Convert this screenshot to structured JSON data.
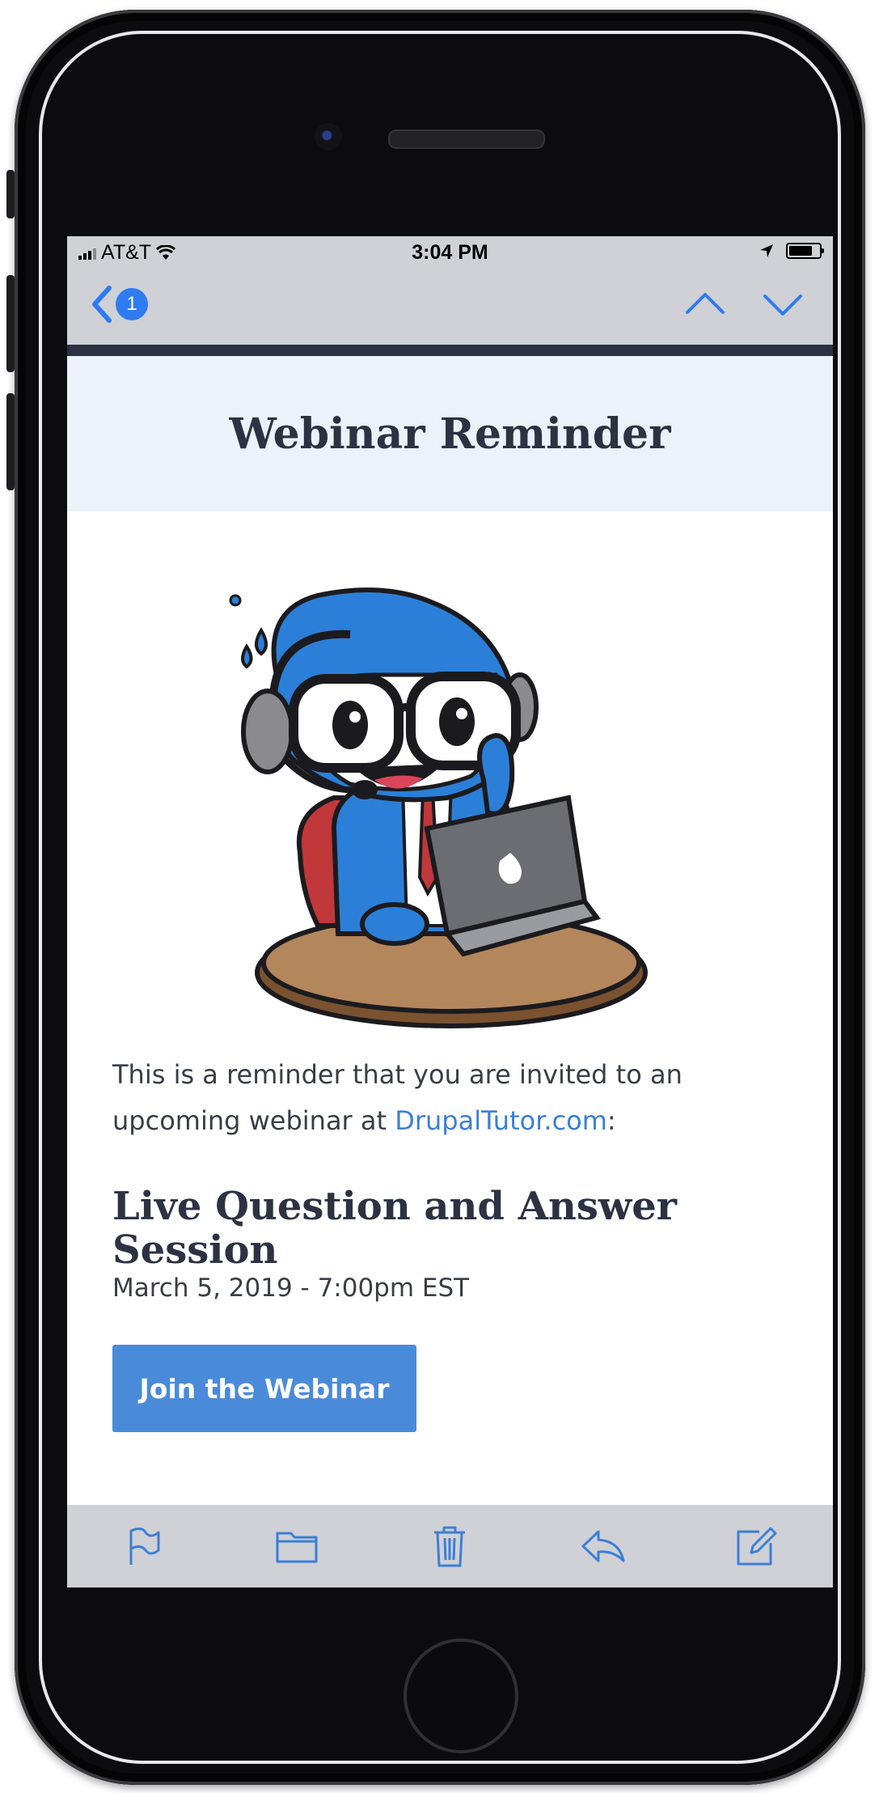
{
  "status_bar": {
    "carrier": "AT&T",
    "time": "3:04 PM"
  },
  "nav": {
    "unread_count": "1",
    "icons": [
      "chevron-left-icon",
      "chevron-up-icon",
      "chevron-down-icon"
    ]
  },
  "email": {
    "header_title": "Webinar Reminder",
    "intro_text": "This is a reminder that you are invited to an upcoming webinar at ",
    "intro_link": "DrupalTutor.com",
    "intro_suffix": ":",
    "webinar_title": "Live Question and Answer Session",
    "webinar_date": "March 5, 2019 - 7:00pm EST",
    "cta_label": "Join the Webinar"
  },
  "toolbar": {
    "icons": [
      "flag-icon",
      "folder-icon",
      "trash-icon",
      "reply-icon",
      "compose-icon"
    ]
  },
  "colors": {
    "accent": "#2f7bf0",
    "link": "#3b7fd6",
    "button": "#4a8bd9",
    "heading": "#2d3243",
    "header_bg": "#ebf2fa",
    "ios_bar": "#cfd1d6"
  }
}
